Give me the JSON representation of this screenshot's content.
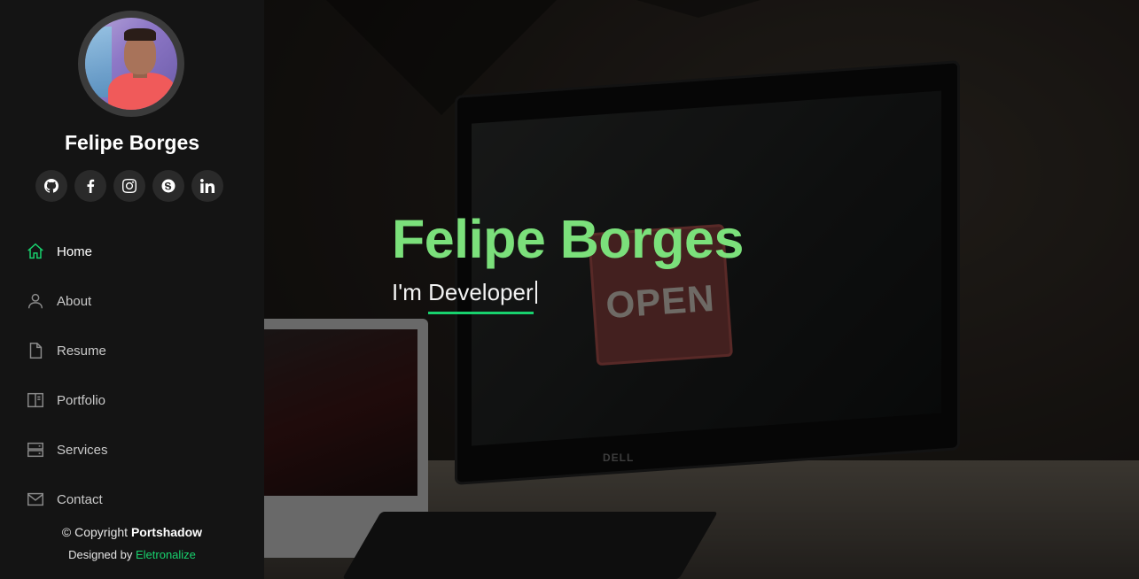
{
  "sidebar": {
    "name": "Felipe Borges",
    "socials": [
      {
        "icon": "github-icon"
      },
      {
        "icon": "facebook-icon"
      },
      {
        "icon": "instagram-icon"
      },
      {
        "icon": "skype-icon"
      },
      {
        "icon": "linkedin-icon"
      }
    ],
    "nav": [
      {
        "label": "Home",
        "icon": "home-icon",
        "active": true
      },
      {
        "label": "About",
        "icon": "user-icon",
        "active": false
      },
      {
        "label": "Resume",
        "icon": "file-icon",
        "active": false
      },
      {
        "label": "Portfolio",
        "icon": "book-icon",
        "active": false
      },
      {
        "label": "Services",
        "icon": "server-icon",
        "active": false
      },
      {
        "label": "Contact",
        "icon": "envelope-icon",
        "active": false
      }
    ],
    "footer": {
      "copyright_prefix": "© Copyright",
      "copyright_brand": "Portshadow",
      "designed_prefix": "Designed by",
      "designed_link": "Eletronalize"
    }
  },
  "hero": {
    "title": "Felipe Borges",
    "subtitle_prefix": "I'm",
    "subtitle_typed": "Developer",
    "sign_text": "OPEN",
    "monitor_brand": "DELL"
  },
  "colors": {
    "accent": "#18d26e",
    "hero_title": "#7be07b",
    "sidebar_bg": "#141414"
  }
}
